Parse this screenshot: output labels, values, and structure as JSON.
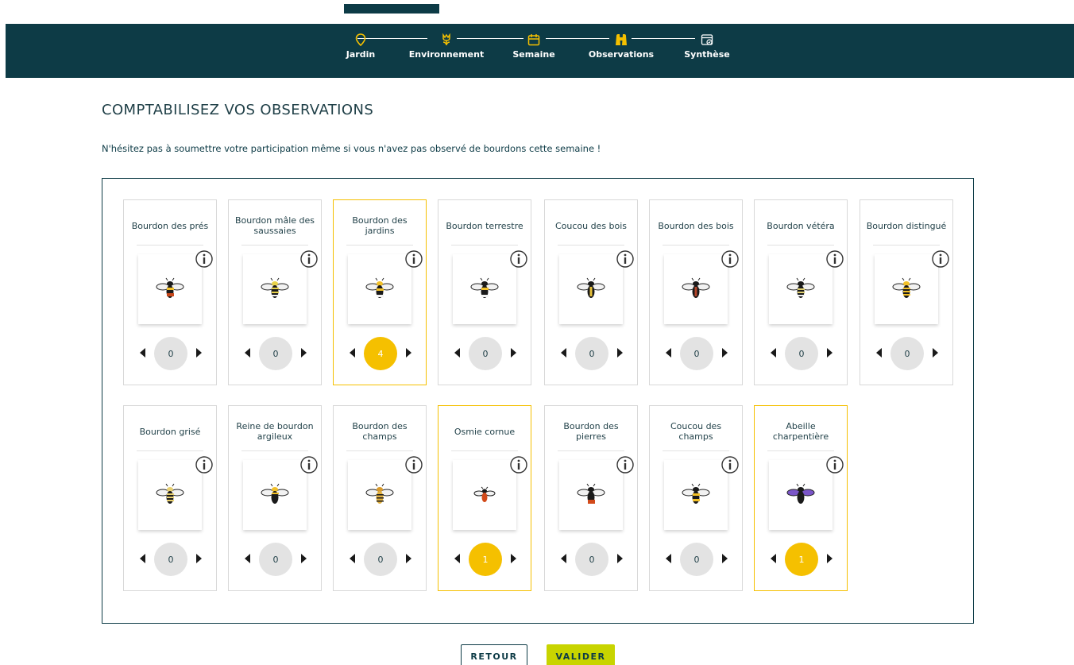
{
  "nav": {
    "steps": [
      {
        "label": "Jardin",
        "icon": "location-pin-icon"
      },
      {
        "label": "Environnement",
        "icon": "flower-icon"
      },
      {
        "label": "Semaine",
        "icon": "calendar-icon"
      },
      {
        "label": "Observations",
        "icon": "binoculars-icon"
      },
      {
        "label": "Synthèse",
        "icon": "summary-calendar-icon"
      }
    ],
    "active_step": "Observations",
    "accent_color": "#f5c000",
    "bar_color": "#0d3b46"
  },
  "page": {
    "title": "COMPTABILISEZ VOS OBSERVATIONS",
    "subtitle": "N'hésitez pas à soumettre votre participation même si vous n'avez pas observé de bourdons cette semaine !"
  },
  "species": [
    {
      "name": "Bourdon des prés",
      "count": "0"
    },
    {
      "name": "Bourdon mâle des saussaies",
      "count": "0"
    },
    {
      "name": "Bourdon des jardins",
      "count": "4"
    },
    {
      "name": "Bourdon terrestre",
      "count": "0"
    },
    {
      "name": "Coucou des bois",
      "count": "0"
    },
    {
      "name": "Bourdon des bois",
      "count": "0"
    },
    {
      "name": "Bourdon vétéra",
      "count": "0"
    },
    {
      "name": "Bourdon distingué",
      "count": "0"
    },
    {
      "name": "Bourdon grisé",
      "count": "0"
    },
    {
      "name": "Reine de bourdon argileux",
      "count": "0"
    },
    {
      "name": "Bourdon des champs",
      "count": "0"
    },
    {
      "name": "Osmie cornue",
      "count": "1"
    },
    {
      "name": "Bourdon des pierres",
      "count": "0"
    },
    {
      "name": "Coucou des champs",
      "count": "0"
    },
    {
      "name": "Abeille charpentière",
      "count": "1"
    }
  ],
  "buttons": {
    "back": "RETOUR",
    "submit": "VALIDER"
  },
  "colors": {
    "selected": "#f5c000",
    "submit": "#c8d400",
    "count_bg": "#e3e3e3"
  }
}
